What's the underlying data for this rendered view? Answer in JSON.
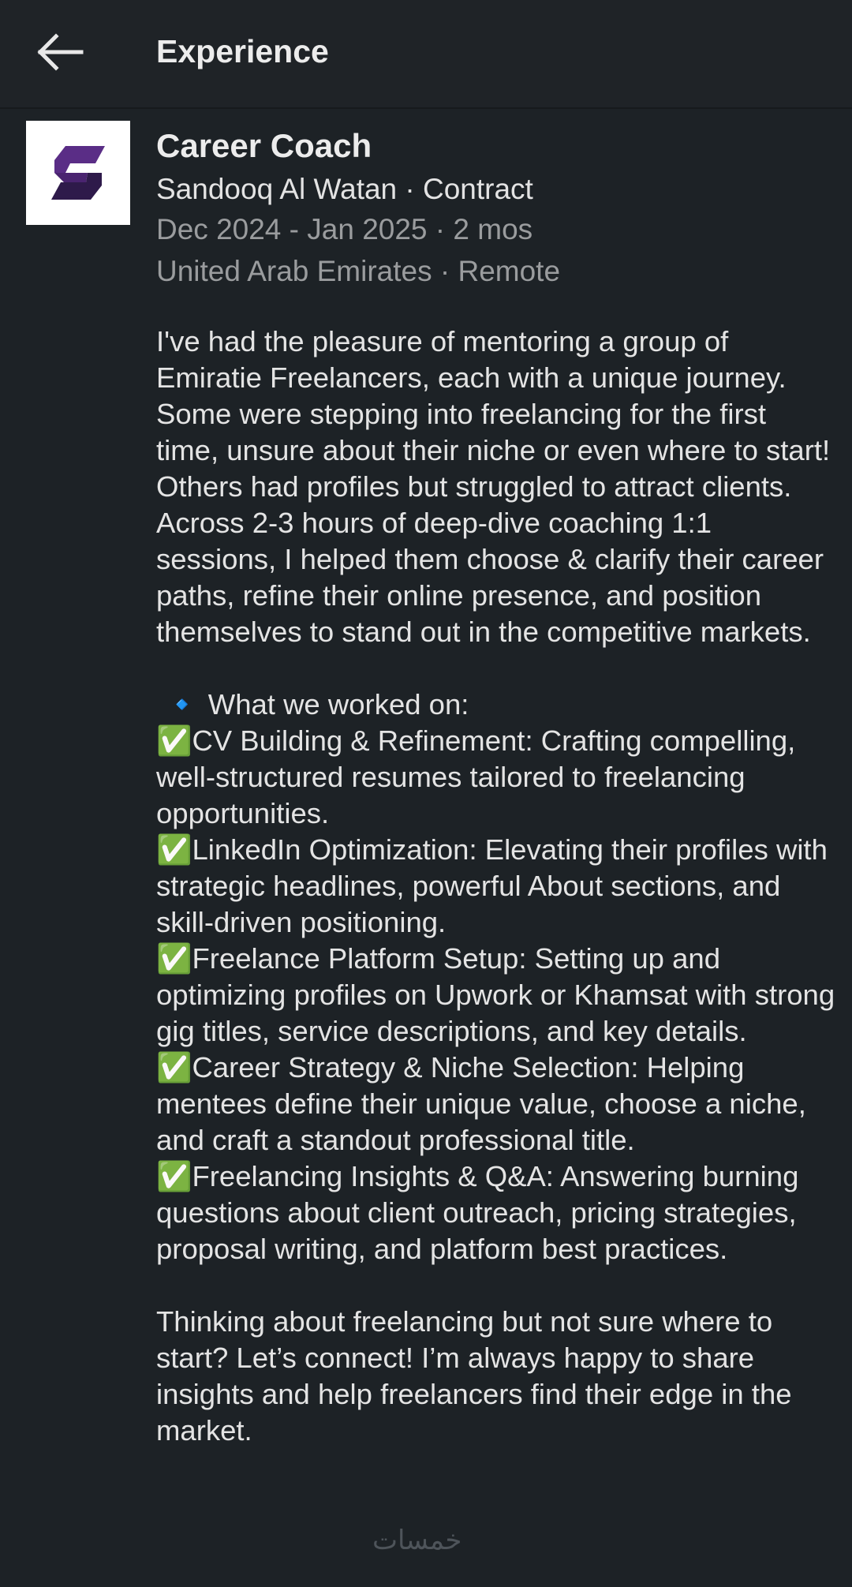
{
  "header": {
    "title": "Experience",
    "back_icon": "arrow-left-icon"
  },
  "experience": {
    "logo_icon": "sandooq-al-watan-logo",
    "logo_colors": [
      "#5a2d86",
      "#2e1a4a"
    ],
    "role": "Career Coach",
    "company_line": "Sandooq Al Watan  · Contract",
    "dates_line": "Dec 2024 - Jan 2025 · 2 mos",
    "location_line": "United Arab Emirates · Remote",
    "description": "I've had the pleasure of mentoring a group of Emiratie Freelancers, each with a unique journey. Some were stepping into freelancing for the first time, unsure about their niche or even where to start! Others had profiles but struggled to attract clients. Across 2-3 hours of deep-dive coaching 1:1 sessions, I helped them choose & clarify their career paths, refine their online presence, and position themselves to stand out in the competitive markets.\n\n 🔹 What we worked on:\n✅CV Building & Refinement: Crafting compelling, well-structured resumes tailored to freelancing opportunities.\n✅LinkedIn Optimization: Elevating their profiles with strategic headlines, powerful About sections, and skill-driven positioning.\n✅Freelance Platform Setup: Setting up and optimizing profiles on Upwork or Khamsat with strong gig titles, service descriptions, and key details.\n✅Career Strategy & Niche Selection: Helping mentees define their unique value, choose a niche, and craft a standout professional title.\n✅Freelancing Insights & Q&A: Answering burning questions about client outreach, pricing strategies, proposal writing, and platform best practices.\n\nThinking about freelancing but not sure where to start? Let’s connect! I’m always happy to share insights and help freelancers find their edge in the market."
  },
  "watermark": "خمسات"
}
